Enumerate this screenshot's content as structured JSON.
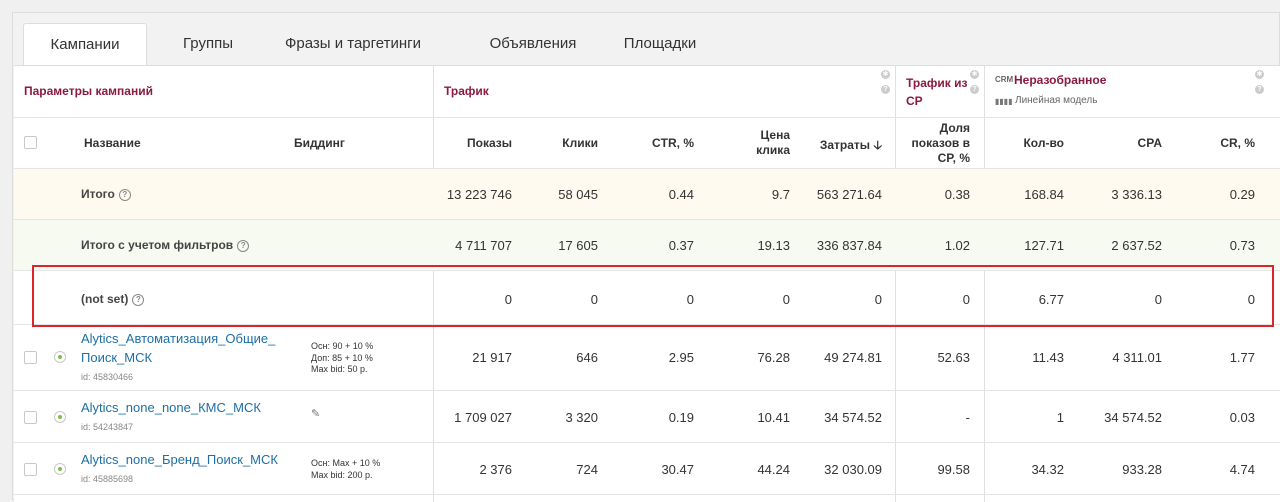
{
  "tabs": [
    {
      "label": "Кампании"
    },
    {
      "label": "Группы"
    },
    {
      "label": "Фразы и таргетинги"
    },
    {
      "label": "Объявления"
    },
    {
      "label": "Площадки"
    }
  ],
  "groups": {
    "params": "Параметры кампаний",
    "traffic": "Трафик",
    "traffic_cp": "Трафик из СР",
    "crm_badge": "CRM",
    "crm": "Неразобранное",
    "crm_model": "Линейная модель"
  },
  "columns": {
    "name": "Название",
    "bidding": "Биддинг",
    "shows": "Показы",
    "clicks": "Клики",
    "ctr": "CTR, %",
    "price": "Цена клика",
    "cost": "Затраты",
    "cost_sort_arrow": "🡣",
    "share": "Доля показов в СР, %",
    "count": "Кол-во",
    "cpa": "CPA",
    "cr": "CR, %"
  },
  "help_glyph": "?",
  "gear_glyph": "✱",
  "rows": [
    {
      "name": "Итого",
      "shows": "13 223 746",
      "clicks": "58 045",
      "ctr": "0.44",
      "price": "9.7",
      "cost": "563 271.64",
      "share": "0.38",
      "count": "168.84",
      "cpa": "3 336.13",
      "cr": "0.29"
    },
    {
      "name": "Итого с учетом фильтров",
      "shows": "4 711 707",
      "clicks": "17 605",
      "ctr": "0.37",
      "price": "19.13",
      "cost": "336 837.84",
      "share": "1.02",
      "count": "127.71",
      "cpa": "2 637.52",
      "cr": "0.73"
    },
    {
      "name": "(not set)",
      "shows": "0",
      "clicks": "0",
      "ctr": "0",
      "price": "0",
      "cost": "0",
      "share": "0",
      "count": "6.77",
      "cpa": "0",
      "cr": "0"
    },
    {
      "name_line1": "Alytics_Автоматизация_Общие_",
      "name_line2": "Поиск_МСК",
      "id": "id: 45830466",
      "bid1": "Осн: 90 + 10 %",
      "bid2": "Доп: 85 + 10 %",
      "bid3": "Max bid: 50 р.",
      "shows": "21 917",
      "clicks": "646",
      "ctr": "2.95",
      "price": "76.28",
      "cost": "49 274.81",
      "share": "52.63",
      "count": "11.43",
      "cpa": "4 311.01",
      "cr": "1.77"
    },
    {
      "name_line1": "Alytics_none_none_КМС_МСК",
      "id": "id: 54243847",
      "bid_icon": "✎",
      "shows": "1 709 027",
      "clicks": "3 320",
      "ctr": "0.19",
      "price": "10.41",
      "cost": "34 574.52",
      "share": "-",
      "count": "1",
      "cpa": "34 574.52",
      "cr": "0.03"
    },
    {
      "name_line1": "Alytics_none_Бренд_Поиск_МСК",
      "id": "id: 45885698",
      "bid1": "Осн: Max + 10 %",
      "bid2": "Max bid: 200 р.",
      "shows": "2 376",
      "clicks": "724",
      "ctr": "30.47",
      "price": "44.24",
      "cost": "32 030.09",
      "share": "99.58",
      "count": "34.32",
      "cpa": "933.28",
      "cr": "4.74"
    }
  ]
}
